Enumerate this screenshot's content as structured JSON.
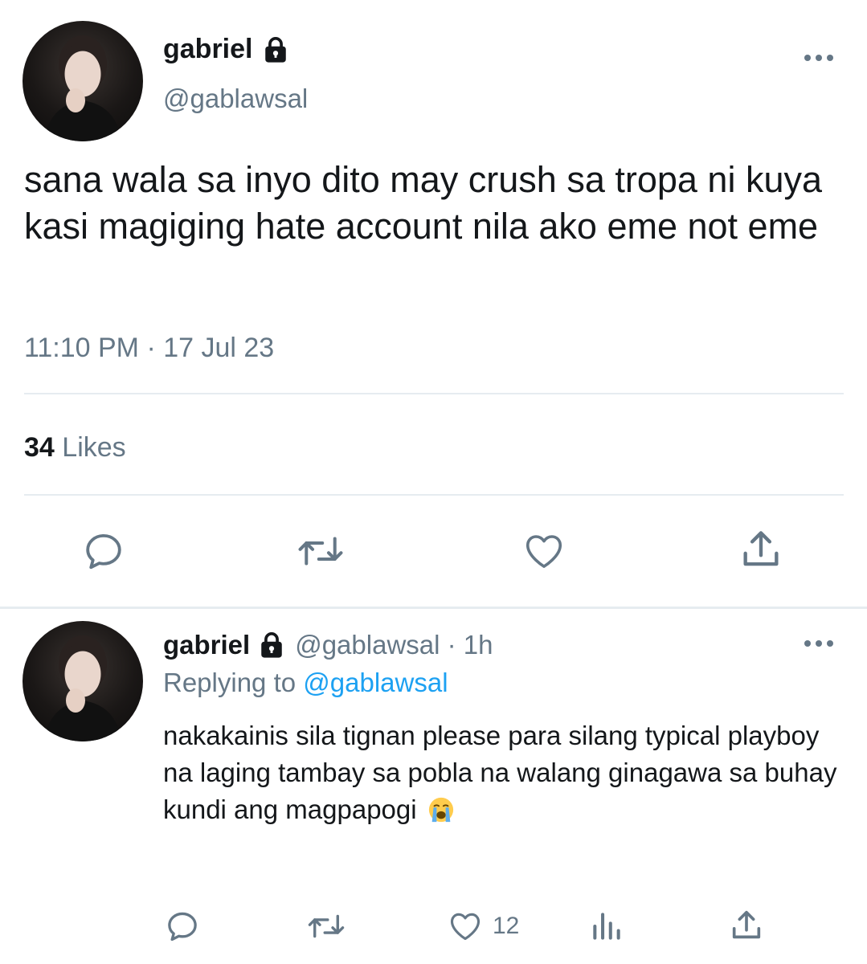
{
  "main_tweet": {
    "display_name": "gabriel",
    "handle": "@gablawsal",
    "text": "sana wala sa inyo dito may crush sa tropa ni kuya kasi magiging hate account nila ako eme not eme",
    "timestamp": "11:10 PM · 17 Jul 23",
    "likes_count": "34",
    "likes_label": "Likes",
    "actions": [
      "reply-icon",
      "retweet-icon",
      "like-icon",
      "share-icon"
    ]
  },
  "reply_tweet": {
    "display_name": "gabriel",
    "handle_time": "@gablawsal · 1h",
    "replying_label": "Replying to",
    "replying_mention": "@gablawsal",
    "text": "nakakainis sila tignan please para silang typical playboy na laging tambay sa pobla na walang ginagawa sa buhay kundi ang magpapogi",
    "emoji": "loudly-crying-face",
    "like_count": "12",
    "actions": [
      "reply-icon",
      "retweet-icon",
      "like-icon",
      "analytics-icon",
      "share-icon"
    ]
  },
  "colors": {
    "text": "#14171a",
    "muted": "#657786",
    "link": "#1da1f2",
    "divider": "#e6ecf0"
  }
}
